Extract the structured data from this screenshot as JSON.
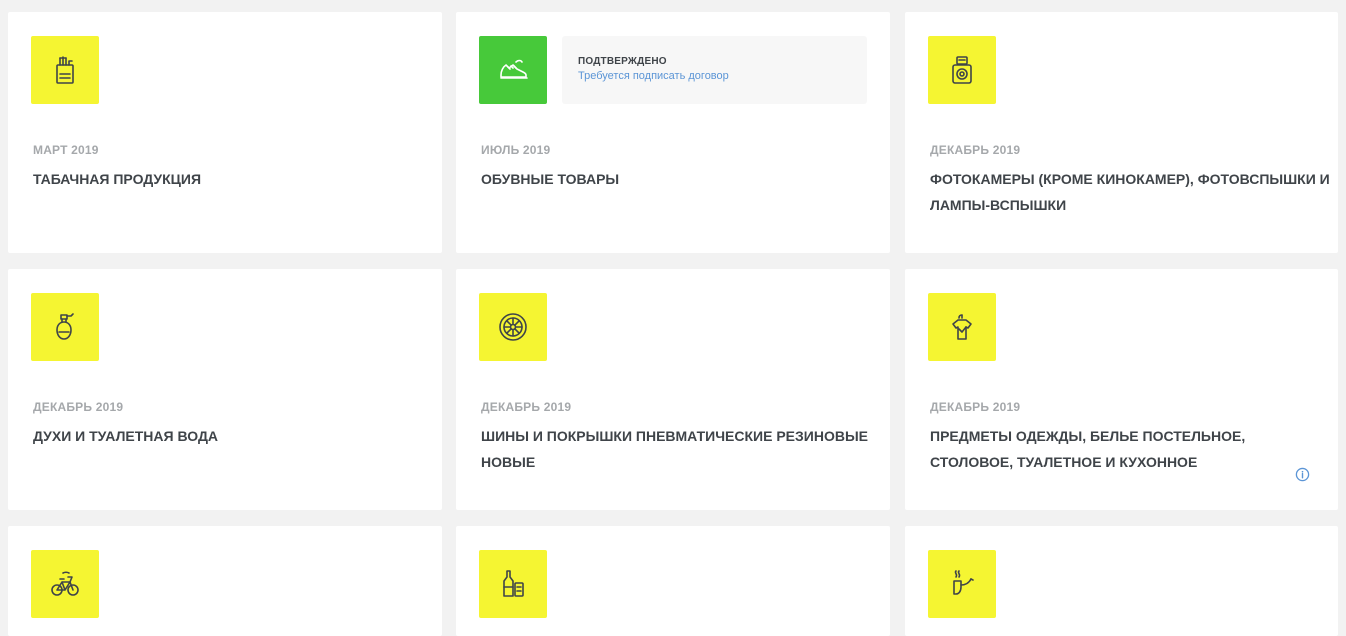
{
  "colors": {
    "tile_yellow": "#f5f532",
    "tile_green": "#47c93a",
    "title_text": "#3f4449",
    "date_text": "#a5a8ab",
    "link_blue": "#5b95d6"
  },
  "cards": [
    {
      "date": "МАРТ 2019",
      "title": "ТАБАЧНАЯ ПРОДУКЦИЯ",
      "icon": "cigarette-pack-icon"
    },
    {
      "date": "ИЮЛЬ 2019",
      "title": "ОБУВНЫЕ ТОВАРЫ",
      "icon": "sneaker-icon",
      "status": {
        "label": "ПОДТВЕРЖДЕНО",
        "link": "Требуется подписать договор"
      }
    },
    {
      "date": "ДЕКАБРЬ 2019",
      "title": "ФОТОКАМЕРЫ (КРОМЕ КИНОКАМЕР), ФОТОВСПЫШКИ И ЛАМПЫ-ВСПЫШКИ",
      "icon": "camera-icon"
    },
    {
      "date": "ДЕКАБРЬ 2019",
      "title": "ДУХИ И ТУАЛЕТНАЯ ВОДА",
      "icon": "perfume-icon"
    },
    {
      "date": "ДЕКАБРЬ 2019",
      "title": "ШИНЫ И ПОКРЫШКИ ПНЕВМАТИЧЕСКИЕ РЕЗИНОВЫЕ НОВЫЕ",
      "icon": "tire-icon"
    },
    {
      "date": "ДЕКАБРЬ 2019",
      "title": "ПРЕДМЕТЫ ОДЕЖДЫ, БЕЛЬЕ ПОСТЕЛЬНОЕ, СТОЛОВОЕ, ТУАЛЕТНОЕ И КУХОННОЕ",
      "icon": "shirt-icon",
      "has_info": true
    },
    {
      "icon": "bicycle-icon"
    },
    {
      "icon": "bottles-icon"
    },
    {
      "icon": "smoking-pipe-icon"
    }
  ]
}
